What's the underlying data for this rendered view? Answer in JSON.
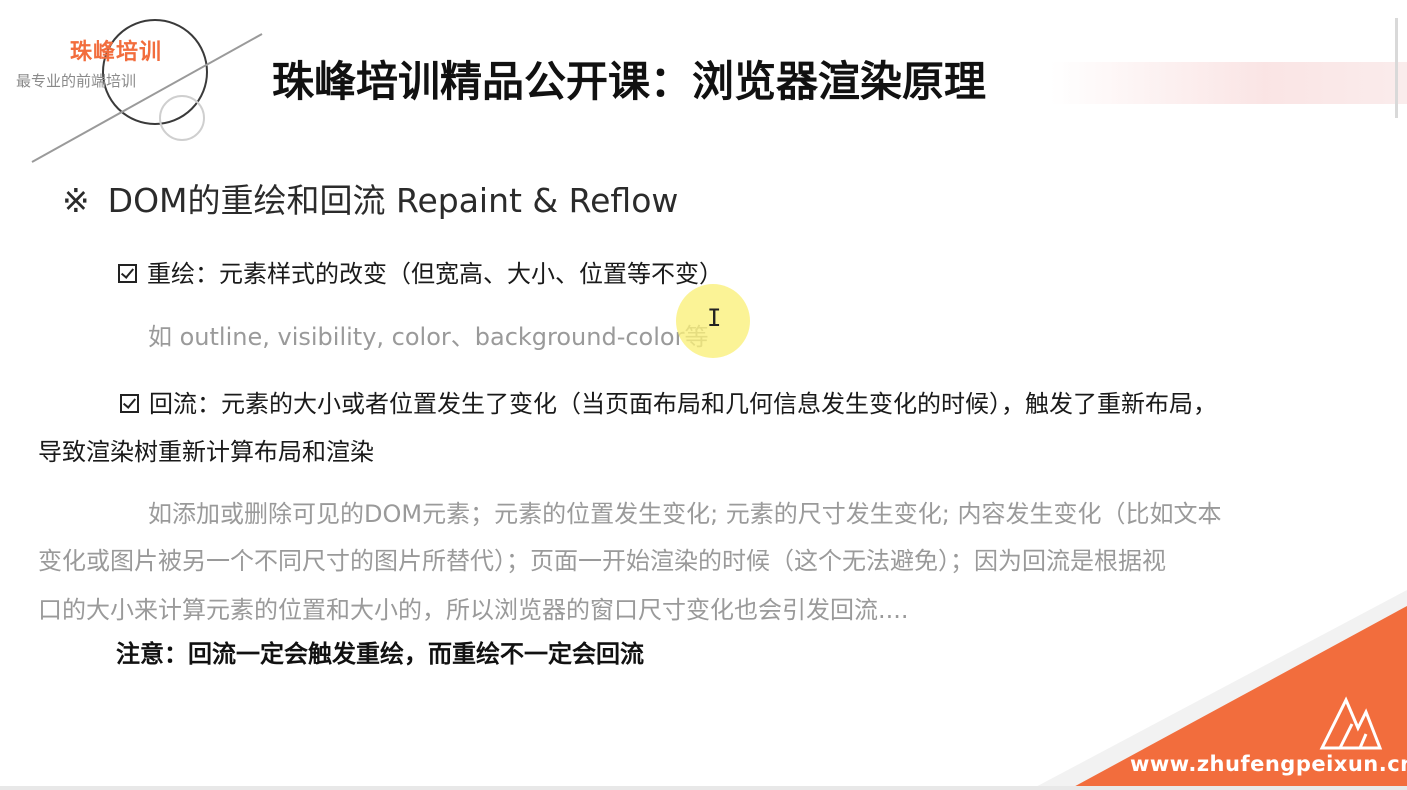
{
  "logo": {
    "name": "珠峰培训",
    "tagline": "最专业的前端培训"
  },
  "title": "珠峰培训精品公开课：浏览器渲染原理",
  "section": {
    "mark": "※",
    "heading": "DOM的重绘和回流 Repaint & Reflow"
  },
  "repaint": {
    "label": "重绘：元素样式的改变（但宽高、大小、位置等不变）",
    "example": "如 outline, visibility, color、background-color等"
  },
  "reflow": {
    "label_line1": "回流：元素的大小或者位置发生了变化（当页面布局和几何信息发生变化的时候），触发了重新布局，",
    "label_line2": "导致渲染树重新计算布局和渲染",
    "example_lines": [
      "如添加或删除可见的DOM元素；元素的位置发生变化; 元素的尺寸发生变化; 内容发生变化（比如文本",
      "变化或图片被另一个不同尺寸的图片所替代）；页面一开始渲染的时候（这个无法避免）；因为回流是根据视",
      "口的大小来计算元素的位置和大小的，所以浏览器的窗口尺寸变化也会引发回流...."
    ]
  },
  "note": "注意：回流一定会触发重绘，而重绘不一定会回流",
  "cursor": {
    "icon": "text-cursor-icon",
    "glyph": "I"
  },
  "footer": {
    "url": "www.zhufengpeixun.cn",
    "accent_color": "#f26d3d"
  },
  "colors": {
    "title": "#111111",
    "body": "#1a1a1a",
    "muted": "#9a9a9a",
    "brand": "#f26d3d",
    "highlight": "#faf078"
  }
}
